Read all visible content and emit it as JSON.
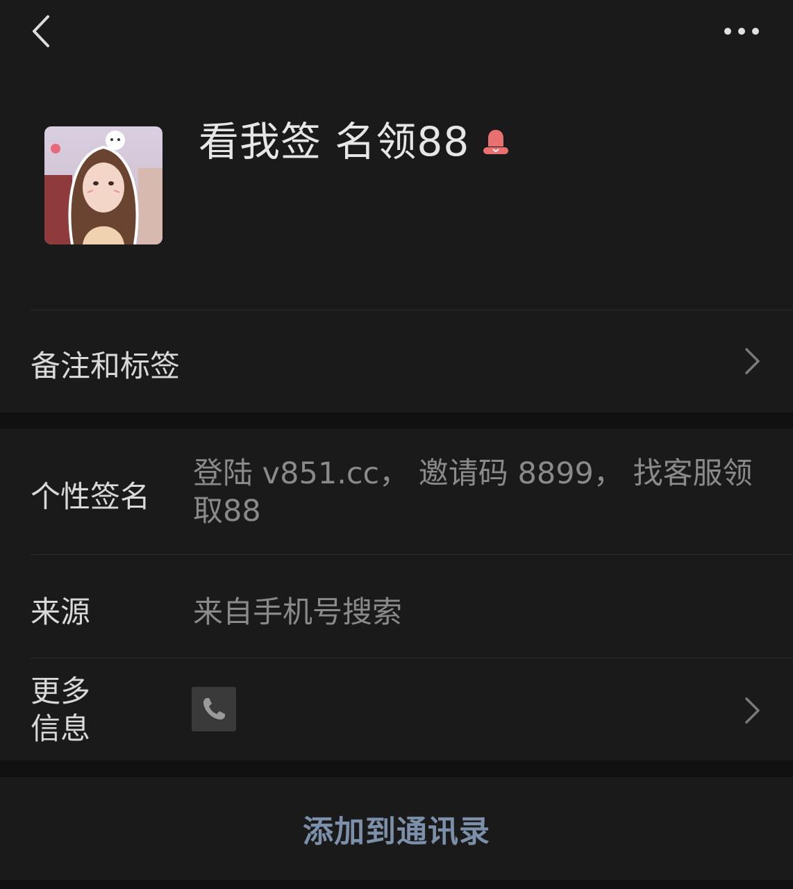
{
  "nav": {
    "back_icon": "chevron-left-icon",
    "more_icon": "more-dots-icon"
  },
  "profile": {
    "nickname": "看我签 名领88",
    "avatar_icon": "avatar-photo",
    "gender_icon": "female-icon",
    "gender_color": "#e8706e"
  },
  "rows": {
    "notes_label": "备注和标签",
    "signature_label": "个性签名",
    "signature_value": "登陆 v851.cc， 邀请码 8899， 找客服领取88",
    "source_label": "来源",
    "source_value": "来自手机号搜索",
    "more_info_label": "更多信息",
    "more_info_icon": "phone-icon"
  },
  "actions": {
    "add_contact": "添加到通讯录"
  },
  "colors": {
    "background": "#111111",
    "card": "#1a1a1a",
    "accent_link": "#7d90aa"
  }
}
